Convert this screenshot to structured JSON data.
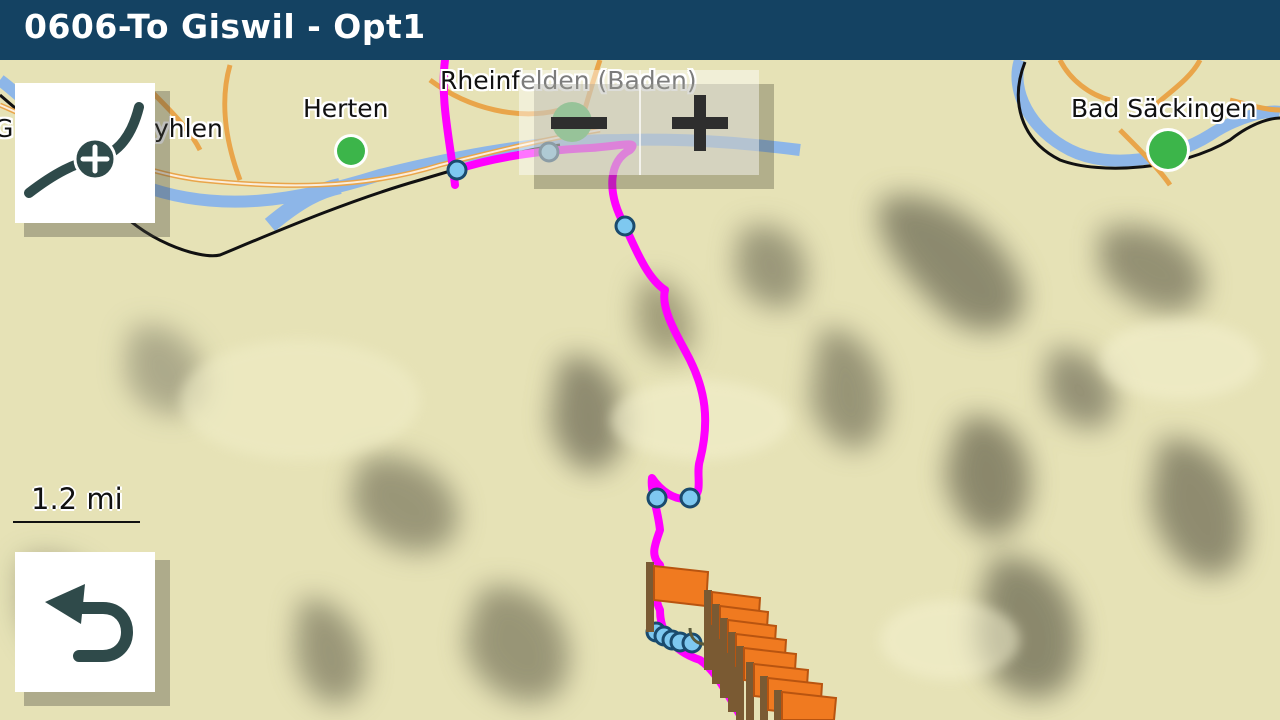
{
  "title": "0606-To Giswil - Opt1",
  "map": {
    "places": [
      {
        "name": "Rheinfelden (Baden)"
      },
      {
        "name": "Herten"
      },
      {
        "name": "Bad Säckingen"
      },
      {
        "name": "G"
      },
      {
        "name": "yhlen"
      }
    ],
    "scale_label": "1.2 mi"
  },
  "controls": {
    "add_route_icon": "curve-plus-icon",
    "zoom_out_icon": "minus-icon",
    "zoom_in_icon": "plus-icon",
    "back_icon": "back-arrow-icon"
  },
  "colors": {
    "title_bar": "#144262",
    "route": "#ff00ff",
    "waypoint": "#7ec8f0",
    "place_dot": "#3cb54a",
    "flag": "#f07a20"
  }
}
